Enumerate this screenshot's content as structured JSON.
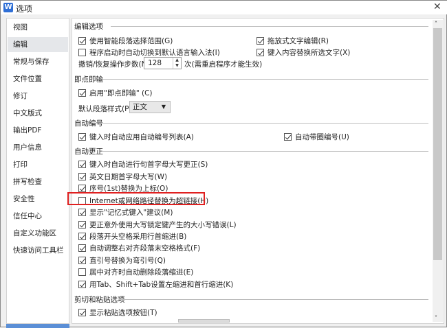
{
  "window": {
    "title": "选项",
    "logo": "W",
    "close": "✕"
  },
  "sidebar": {
    "items": [
      "视图",
      "编辑",
      "常规与保存",
      "文件位置",
      "修订",
      "中文版式",
      "输出PDF",
      "用户信息",
      "打印",
      "拼写检查",
      "安全性",
      "信任中心",
      "自定义功能区",
      "快速访问工具栏"
    ],
    "selected": "编辑"
  },
  "edit_options": {
    "header": "编辑选项",
    "smart_select": {
      "label": "使用智能段落选择范围(G)",
      "checked": true
    },
    "drag_edit": {
      "label": "拖放式文字编辑(R)",
      "checked": true
    },
    "auto_ime": {
      "label": "程序启动时自动切换到默认语言输入法(I)",
      "checked": false
    },
    "replace_sel": {
      "label": "键入内容替换所选文字(X)",
      "checked": true
    },
    "undo_label": "撤销/恢复操作步数(N):",
    "undo_value": "128",
    "undo_note": "次(需重启程序才能生效)"
  },
  "click_type": {
    "header": "即点即输",
    "enable": {
      "label": "启用\"即点即输\" (C)",
      "checked": true
    },
    "style_label": "默认段落样式(P):",
    "style_value": "正文"
  },
  "auto_number": {
    "header": "自动编号",
    "list": {
      "label": "键入时自动应用自动编号列表(A)",
      "checked": true
    },
    "circle": {
      "label": "自动带圈编号(U)",
      "checked": true
    }
  },
  "autocorrect": {
    "header": "自动更正",
    "items": [
      {
        "label": "键入时自动进行句首字母大写更正(S)",
        "checked": true
      },
      {
        "label": "英文日期首字母大写(W)",
        "checked": true
      },
      {
        "label": "序号(1st)替换为上标(O)",
        "checked": true
      },
      {
        "label": "Internet或网络路径替换为超链接(H)",
        "checked": false
      },
      {
        "label": "显示\"记忆式键入\"建议(M)",
        "checked": true
      },
      {
        "label": "更正意外使用大写锁定键产生的大小写错误(L)",
        "checked": true
      },
      {
        "label": "段落开头空格采用行首缩进(B)",
        "checked": true
      },
      {
        "label": "自动调整右对齐段落末空格格式(F)",
        "checked": true
      },
      {
        "label": "直引号替换为弯引号(Q)",
        "checked": true
      },
      {
        "label": "居中对齐时自动删除段落缩进(E)",
        "checked": false
      },
      {
        "label": "用Tab、Shift+Tab设置左缩进和首行缩进(K)",
        "checked": true
      }
    ]
  },
  "paste": {
    "header": "剪切和粘贴选项",
    "show_btn": {
      "label": "显示粘贴选项按钮(T)",
      "checked": true
    }
  },
  "colors": {
    "accent": "#2f6fd6",
    "highlight": "#e02020"
  }
}
